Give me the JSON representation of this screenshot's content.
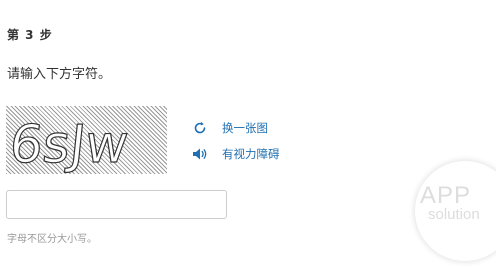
{
  "step": {
    "title": "第 3 步"
  },
  "instruction": "请输入下方字符。",
  "captcha": {
    "code_text": "6sJw",
    "icon": "distorted-captcha-image"
  },
  "actions": [
    {
      "label": "换一张图",
      "icon": "refresh-icon"
    },
    {
      "label": "有视力障碍",
      "icon": "speaker-icon"
    }
  ],
  "input": {
    "value": "",
    "placeholder": ""
  },
  "hint": "字母不区分大小写。",
  "watermark": {
    "line1": "APP",
    "line2": "solution"
  },
  "colors": {
    "link": "#1f6fb2",
    "text": "#333333",
    "hint": "#999999"
  }
}
